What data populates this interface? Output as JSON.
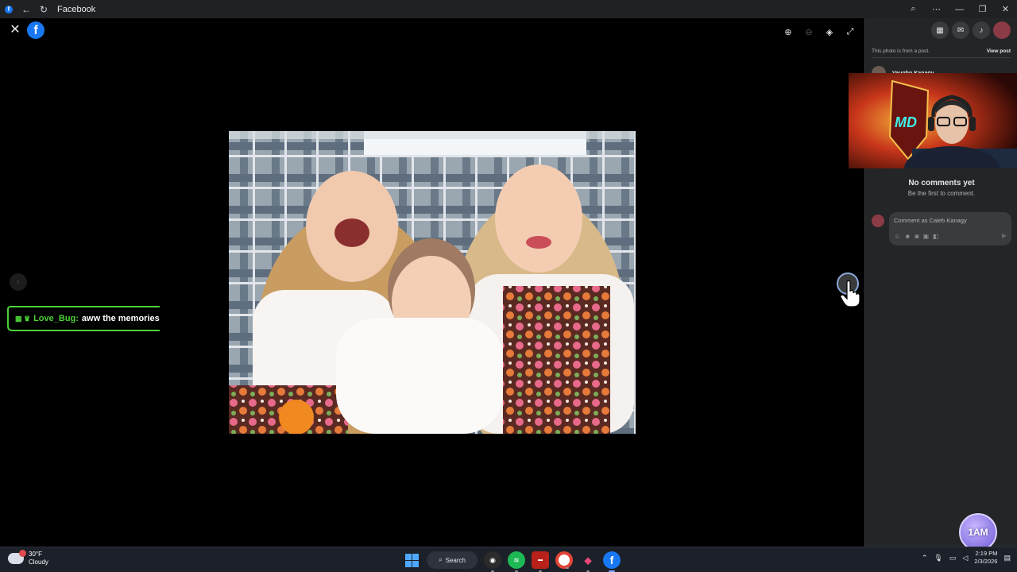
{
  "window": {
    "title": "Facebook",
    "back_icon": "arrow-left-icon",
    "reload_icon": "reload-icon"
  },
  "viewer": {
    "close_icon": "close-icon",
    "tools": [
      "zoom-in-icon",
      "zoom-out-icon",
      "tag-icon",
      "fullscreen-icon"
    ],
    "next_icon": "chevron-right-icon",
    "prev_icon": "chevron-left-icon"
  },
  "chat_overlay": {
    "badges": "▦ ♛",
    "username": "Love_Bug:",
    "message": "aww the memories",
    "accent": "#4cd137"
  },
  "sidebar": {
    "photo_note": "This photo is from a post.",
    "view_post": "View post",
    "author": "Vaughn Kanagy",
    "no_comments_title": "No comments yet",
    "no_comments_sub": "Be the first to comment.",
    "comment_placeholder": "Comment as Caleb Kanagy",
    "comment_tools": [
      "gif-icon",
      "emoji-icon",
      "camera-icon",
      "gif-icon",
      "sticker-icon"
    ]
  },
  "webcam": {
    "logo_text": "MD"
  },
  "streamer_badge": {
    "text": "1AM"
  },
  "taskbar": {
    "weather_temp": "30°F",
    "weather_desc": "Cloudy",
    "search_label": "Search",
    "time": "2:19 PM",
    "date": "2/3/2026"
  },
  "colors": {
    "facebook_blue": "#1877f2",
    "sidebar_bg": "#242526",
    "taskbar_bg": "#1c2029"
  }
}
